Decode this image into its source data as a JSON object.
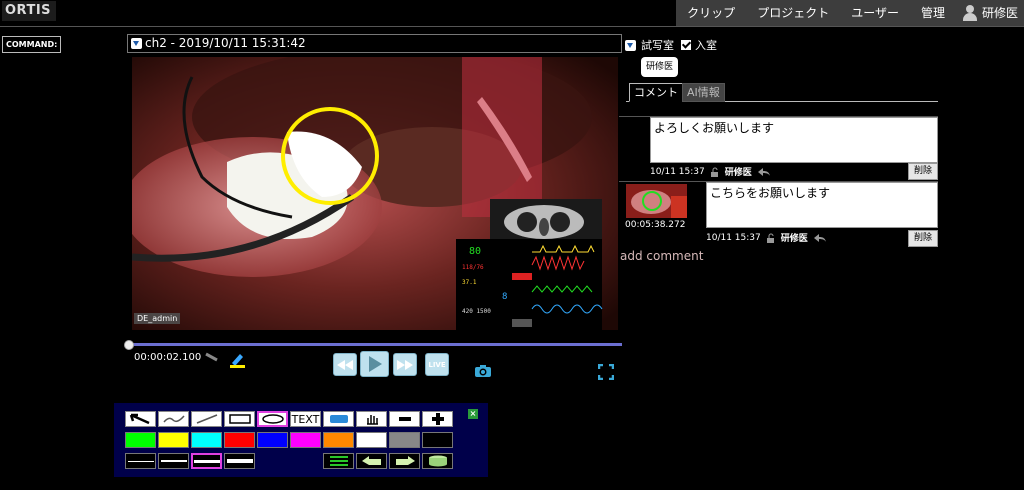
{
  "brand": {
    "logo_text": "ORTIS"
  },
  "nav": {
    "items": [
      {
        "label": "クリップ"
      },
      {
        "label": "プロジェクト"
      },
      {
        "label": "ユーザー"
      },
      {
        "label": "管理"
      }
    ],
    "user_label": "研修医"
  },
  "command": {
    "label": "COMMAND:"
  },
  "channel": {
    "selected": "ch2 - 2019/10/11 15:31:42"
  },
  "room": {
    "selected": "試写室",
    "checkbox_label": "入室",
    "checked": true
  },
  "badge": {
    "user": "研修医"
  },
  "video": {
    "overlay_label": "DE_admin"
  },
  "player": {
    "current_time": "00:00:02.100",
    "progress": 0.0,
    "live_label": "LIVE"
  },
  "comments": {
    "tabs": [
      {
        "label": "コメント",
        "active": true
      },
      {
        "label": "AI情報",
        "active": false
      }
    ],
    "items": [
      {
        "text": "よろしくお願いします",
        "date": "10/11 15:37",
        "user": "研修医",
        "delete_label": "削除",
        "has_thumbnail": false
      },
      {
        "text": "こちらをお願いします",
        "date": "10/11 15:37",
        "user": "研修医",
        "delete_label": "削除",
        "has_thumbnail": true,
        "thumbnail_time": "00:05:38.272"
      }
    ],
    "add_label": "add comment"
  },
  "palette": {
    "tools": [
      "arrow-tool",
      "freehand-tool",
      "line-tool",
      "rectangle-tool",
      "ellipse-tool",
      "text-tool",
      "eraser-tool",
      "hand-tool",
      "zoom-out-tool",
      "zoom-in-tool"
    ],
    "text_tool_label": "TEXT",
    "selected_tool": "ellipse-tool",
    "colors": [
      "#00ff00",
      "#ffff00",
      "#00ffff",
      "#ff0000",
      "#0000ff",
      "#ff00ff",
      "#ff8800",
      "#ffffff",
      "#888888",
      "#000000"
    ],
    "line_widths": [
      "thin",
      "medium",
      "thick",
      "extra-thick"
    ],
    "selected_line_width": "thick",
    "actions": [
      "list-icon",
      "undo-icon",
      "redo-icon",
      "clear-icon"
    ],
    "close_label": "×"
  },
  "colors": {
    "annotation_circle": "#ffee00",
    "seekbar": "#6b6fd0",
    "nav_bg": "#3d3d3d",
    "palette_bg": "#00004a",
    "selected_tool_border": "#e040e0"
  }
}
